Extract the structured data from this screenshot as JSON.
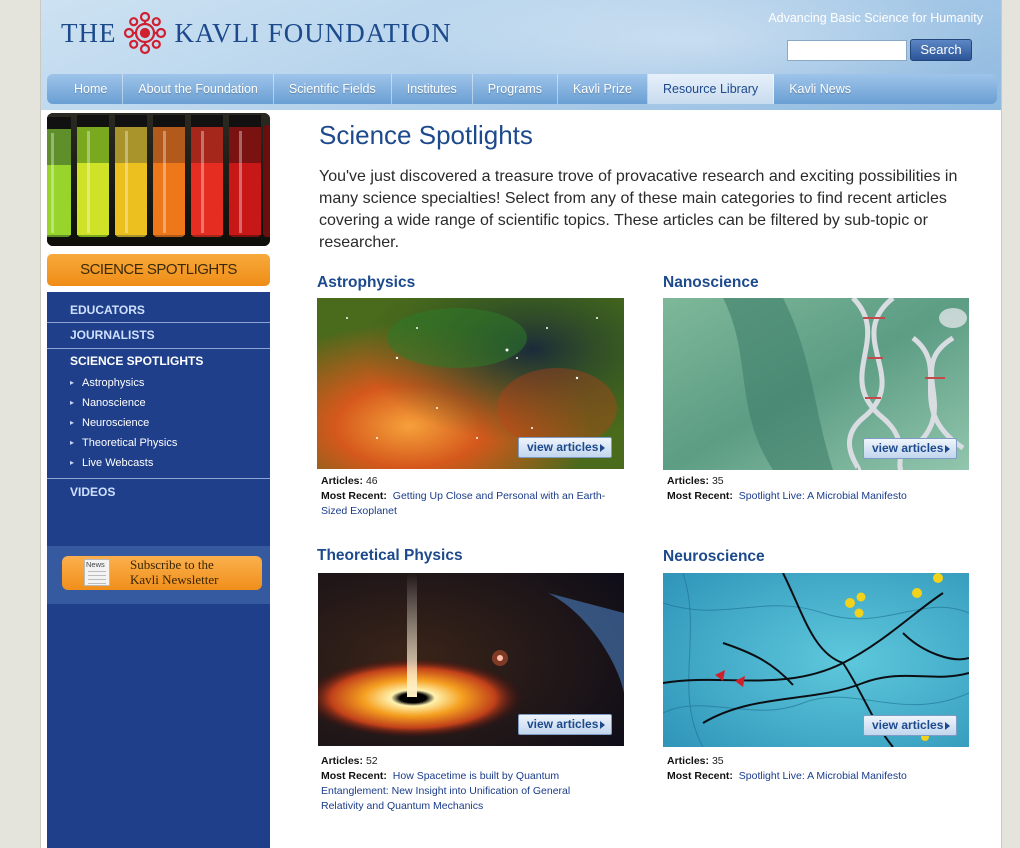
{
  "header": {
    "logo_left": "THE",
    "logo_right": "KAVLI FOUNDATION",
    "tagline": "Advancing Basic Science for Humanity",
    "search_placeholder": "",
    "search_button": "Search"
  },
  "nav": {
    "items": [
      {
        "label": "Home"
      },
      {
        "label": "About the Foundation"
      },
      {
        "label": "Scientific Fields"
      },
      {
        "label": "Institutes"
      },
      {
        "label": "Programs"
      },
      {
        "label": "Kavli Prize"
      },
      {
        "label": "Resource Library",
        "active": true
      },
      {
        "label": "Kavli News"
      }
    ]
  },
  "sidebar": {
    "banner": "SCIENCE SPOTLIGHTS",
    "sections": [
      "EDUCATORS",
      "JOURNALISTS",
      "SCIENCE SPOTLIGHTS",
      "VIDEOS"
    ],
    "sub_items": [
      "Astrophysics",
      "Nanoscience",
      "Neuroscience",
      "Theoretical Physics",
      "Live Webcasts"
    ],
    "newsletter_icon_label": "News",
    "newsletter_line1": "Subscribe to the",
    "newsletter_line2": "Kavli Newsletter"
  },
  "main": {
    "title": "Science Spotlights",
    "intro": "You've just discovered a treasure trove of provacative research and exciting possibilities in many science specialties! Select from any of these main categories to find recent articles covering a wide range of scientific topics. These articles can be filtered by sub-topic or researcher.",
    "articles_label": "Articles:",
    "most_recent_label": "Most Recent:",
    "view_label": "view articles",
    "cards": [
      {
        "heading": "Astrophysics",
        "articles": "46",
        "recent": "Getting Up Close and Personal with an Earth-Sized Exoplanet"
      },
      {
        "heading": "Nanoscience",
        "articles": "35",
        "recent": "Spotlight Live: A Microbial Manifesto"
      },
      {
        "heading": "Theoretical Physics",
        "articles": "52",
        "recent": "How Spacetime is built by Quantum Entanglement: New Insight into Unification of General Relativity and Quantum Mechanics"
      },
      {
        "heading": "Neuroscience",
        "articles": "35",
        "recent": "Spotlight Live: A Microbial Manifesto"
      }
    ]
  }
}
